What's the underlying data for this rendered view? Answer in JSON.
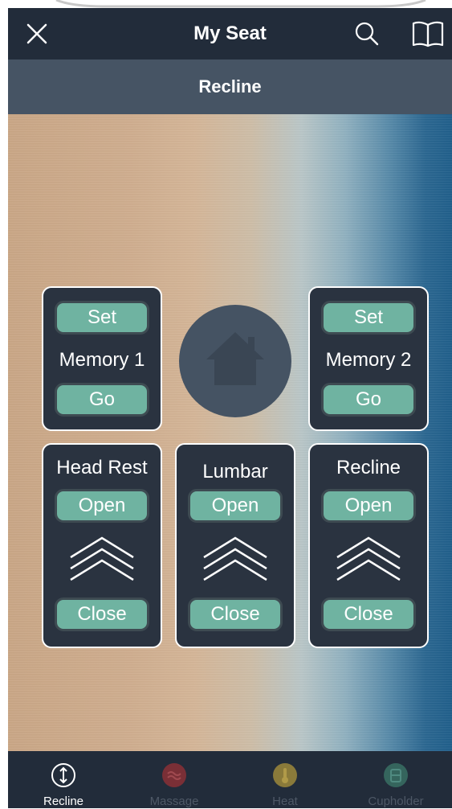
{
  "nav": {
    "title": "My Seat"
  },
  "subheader": {
    "title": "Recline"
  },
  "memory_cards": [
    {
      "set_label": "Set",
      "name": "Memory 1",
      "go_label": "Go"
    },
    {
      "set_label": "Set",
      "name": "Memory 2",
      "go_label": "Go"
    }
  ],
  "adjust_cards": [
    {
      "name": "Head Rest",
      "open_label": "Open",
      "close_label": "Close"
    },
    {
      "name": "Lumbar",
      "open_label": "Open",
      "close_label": "Close"
    },
    {
      "name": "Recline",
      "open_label": "Open",
      "close_label": "Close"
    }
  ],
  "tabs": [
    {
      "label": "Recline",
      "icon": "recline-arrow-icon",
      "active": true
    },
    {
      "label": "Massage",
      "icon": "massage-icon",
      "active": false
    },
    {
      "label": "Heat",
      "icon": "heat-icon",
      "active": false
    },
    {
      "label": "Cupholder",
      "icon": "cupholder-icon",
      "active": false
    }
  ],
  "colors": {
    "nav_bg": "#222c3a",
    "subheader_bg": "#465464",
    "card_bg": "#2a3340",
    "button_bg": "#6fb3a1",
    "massage_icon": "#7a2f36",
    "heat_icon": "#8a7a3a",
    "cupholder_icon": "#35655d"
  }
}
